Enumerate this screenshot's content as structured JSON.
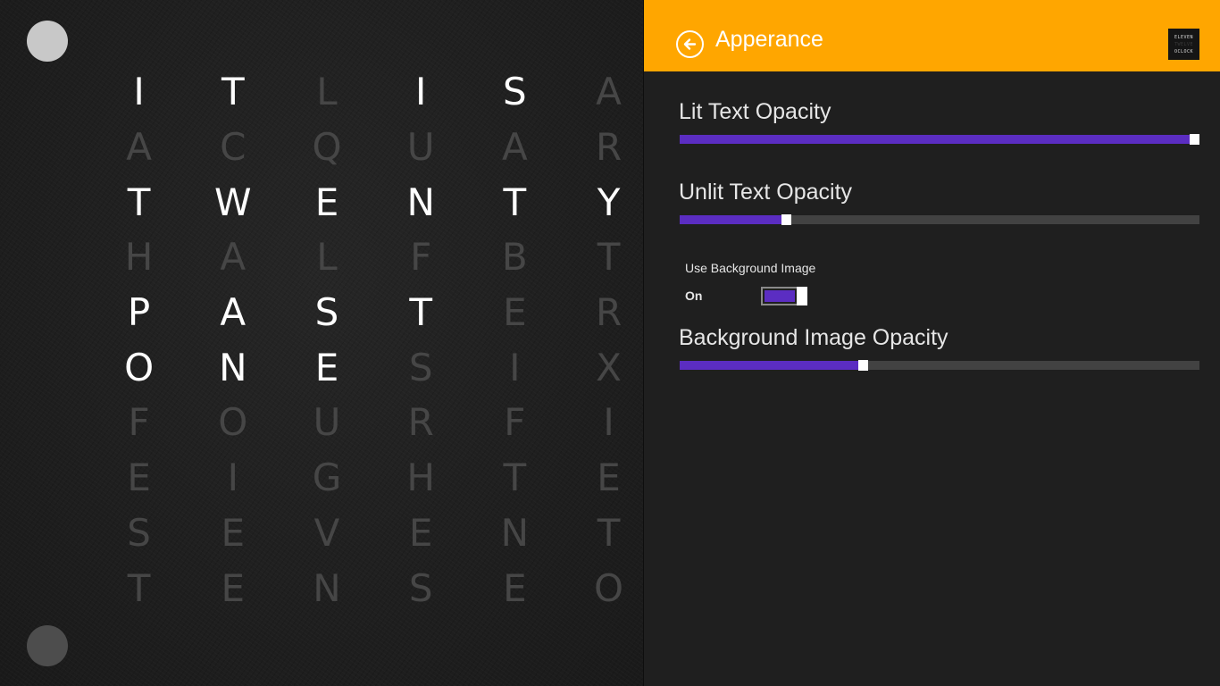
{
  "clock": {
    "rows": [
      [
        {
          "c": "I",
          "lit": true
        },
        {
          "c": "T",
          "lit": true
        },
        {
          "c": "L",
          "lit": false
        },
        {
          "c": "I",
          "lit": true
        },
        {
          "c": "S",
          "lit": true
        },
        {
          "c": "A",
          "lit": false
        }
      ],
      [
        {
          "c": "A",
          "lit": false
        },
        {
          "c": "C",
          "lit": false
        },
        {
          "c": "Q",
          "lit": false
        },
        {
          "c": "U",
          "lit": false
        },
        {
          "c": "A",
          "lit": false
        },
        {
          "c": "R",
          "lit": false
        }
      ],
      [
        {
          "c": "T",
          "lit": true
        },
        {
          "c": "W",
          "lit": true
        },
        {
          "c": "E",
          "lit": true
        },
        {
          "c": "N",
          "lit": true
        },
        {
          "c": "T",
          "lit": true
        },
        {
          "c": "Y",
          "lit": true
        }
      ],
      [
        {
          "c": "H",
          "lit": false
        },
        {
          "c": "A",
          "lit": false
        },
        {
          "c": "L",
          "lit": false
        },
        {
          "c": "F",
          "lit": false
        },
        {
          "c": "B",
          "lit": false
        },
        {
          "c": "T",
          "lit": false
        }
      ],
      [
        {
          "c": "P",
          "lit": true
        },
        {
          "c": "A",
          "lit": true
        },
        {
          "c": "S",
          "lit": true
        },
        {
          "c": "T",
          "lit": true
        },
        {
          "c": "E",
          "lit": false
        },
        {
          "c": "R",
          "lit": false
        }
      ],
      [
        {
          "c": "O",
          "lit": true
        },
        {
          "c": "N",
          "lit": true
        },
        {
          "c": "E",
          "lit": true
        },
        {
          "c": "S",
          "lit": false
        },
        {
          "c": "I",
          "lit": false
        },
        {
          "c": "X",
          "lit": false
        }
      ],
      [
        {
          "c": "F",
          "lit": false
        },
        {
          "c": "O",
          "lit": false
        },
        {
          "c": "U",
          "lit": false
        },
        {
          "c": "R",
          "lit": false
        },
        {
          "c": "F",
          "lit": false
        },
        {
          "c": "I",
          "lit": false
        }
      ],
      [
        {
          "c": "E",
          "lit": false
        },
        {
          "c": "I",
          "lit": false
        },
        {
          "c": "G",
          "lit": false
        },
        {
          "c": "H",
          "lit": false
        },
        {
          "c": "T",
          "lit": false
        },
        {
          "c": "E",
          "lit": false
        }
      ],
      [
        {
          "c": "S",
          "lit": false
        },
        {
          "c": "E",
          "lit": false
        },
        {
          "c": "V",
          "lit": false
        },
        {
          "c": "E",
          "lit": false
        },
        {
          "c": "N",
          "lit": false
        },
        {
          "c": "T",
          "lit": false
        }
      ],
      [
        {
          "c": "T",
          "lit": false
        },
        {
          "c": "E",
          "lit": false
        },
        {
          "c": "N",
          "lit": false
        },
        {
          "c": "S",
          "lit": false
        },
        {
          "c": "E",
          "lit": false
        },
        {
          "c": "O",
          "lit": false
        }
      ]
    ]
  },
  "header": {
    "title": "Apperance",
    "accent_color": "#ffa600",
    "back_icon": "back-arrow-circle-icon",
    "logo_lines": [
      "ELEVEN",
      "TWELVE",
      "OCLOCK"
    ]
  },
  "settings": {
    "accent_color": "#5b2dc2",
    "lit_text_opacity": {
      "label": "Lit Text Opacity",
      "value": 1.0
    },
    "unlit_text_opacity": {
      "label": "Unlit Text Opacity",
      "value": 0.2
    },
    "use_background_image": {
      "label": "Use Background Image",
      "state": "On",
      "checked": true
    },
    "background_image_opacity": {
      "label": "Background Image Opacity",
      "value": 0.35
    }
  }
}
